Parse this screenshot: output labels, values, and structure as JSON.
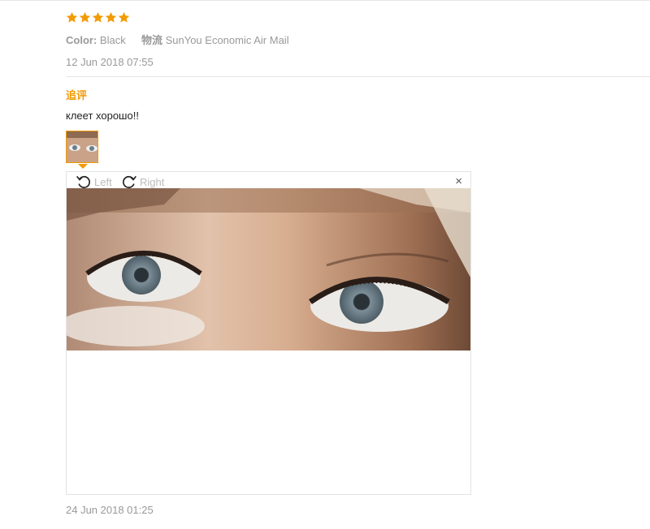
{
  "review": {
    "rating": 5,
    "color_label": "Color:",
    "color_value": "Black",
    "shipping_label": "物流",
    "shipping_value": "SunYou Economic Air Mail",
    "date": "12 Jun 2018 07:55"
  },
  "followup": {
    "label": "追评",
    "text": "клеет хорошо!!",
    "date": "24 Jun 2018 01:25"
  },
  "viewer": {
    "rotate_left_label": "Left",
    "rotate_right_label": "Right",
    "close_label": "×"
  },
  "colors": {
    "star": "#f29b05",
    "accent": "#f29b05",
    "muted_text": "#999999"
  },
  "icons": [
    "star-icon",
    "rotate-left-icon",
    "rotate-right-icon",
    "close-icon"
  ]
}
